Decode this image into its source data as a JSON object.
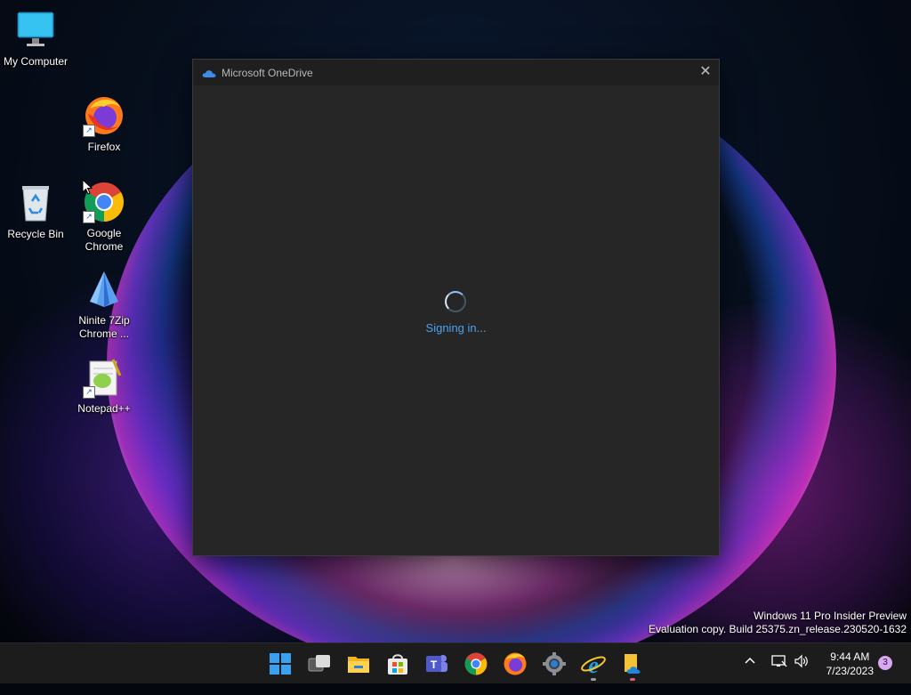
{
  "desktop": {
    "icons": [
      {
        "label": "My Computer"
      },
      {
        "label": "Firefox"
      },
      {
        "label": "Recycle Bin"
      },
      {
        "label": "Google Chrome"
      },
      {
        "label": "Ninite 7Zip Chrome ..."
      },
      {
        "label": "Notepad++"
      }
    ]
  },
  "window": {
    "title": "Microsoft OneDrive",
    "close_label": "✕",
    "status": "Signing in..."
  },
  "watermark": {
    "line1": "Windows 11 Pro Insider Preview",
    "line2": "Evaluation copy. Build 25375.zn_release.230520-1632"
  },
  "taskbar": {
    "apps": [
      "start-icon",
      "task-view-icon",
      "file-explorer-icon",
      "microsoft-store-icon",
      "teams-icon",
      "chrome-icon",
      "firefox-icon",
      "settings-icon",
      "internet-explorer-icon",
      "onedrive-setup-icon"
    ],
    "tray": {
      "chevron": "^",
      "time": "9:44 AM",
      "date": "7/23/2023",
      "notification_count": "3"
    }
  },
  "colors": {
    "window_bg": "#262626",
    "titlebar_bg": "#1f1f1f",
    "status_text": "#4aa3ef",
    "taskbar_bg": "#1c1c1c"
  }
}
